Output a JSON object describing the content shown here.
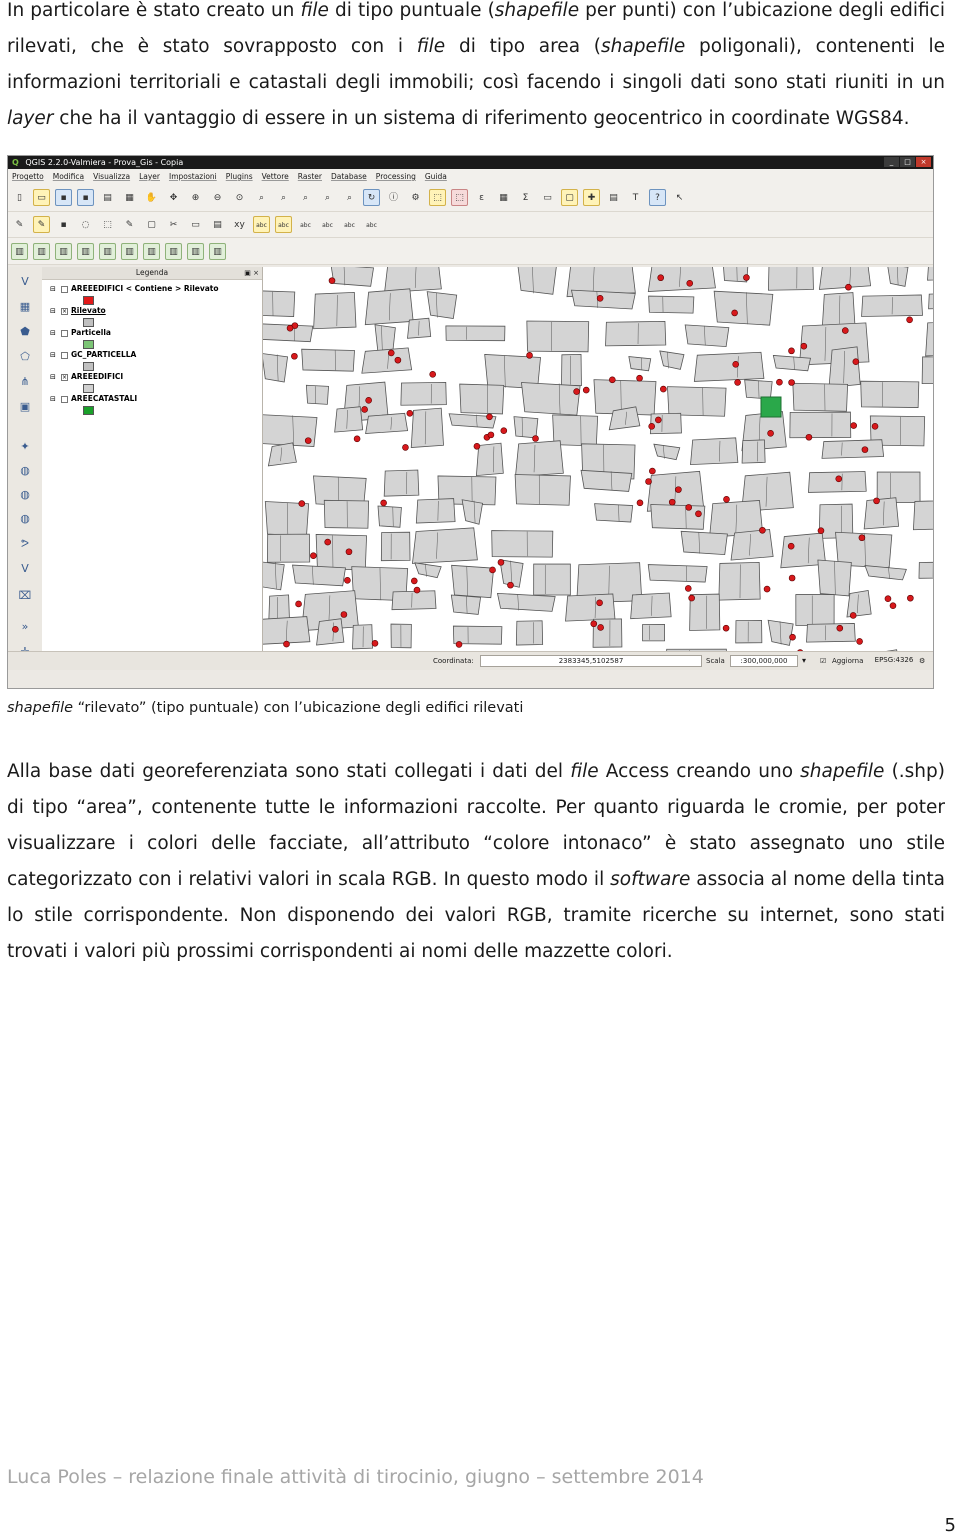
{
  "paragraph1": {
    "runs": [
      {
        "t": "In particolare è stato creato un ",
        "i": false
      },
      {
        "t": "file",
        "i": true
      },
      {
        "t": " di tipo puntuale (",
        "i": false
      },
      {
        "t": "shapefile",
        "i": true
      },
      {
        "t": " per punti) con l’ubicazione degli edifici rilevati, che è stato sovrapposto con i ",
        "i": false
      },
      {
        "t": "file",
        "i": true
      },
      {
        "t": " di tipo area (",
        "i": false
      },
      {
        "t": "shapefile",
        "i": true
      },
      {
        "t": " poligonali), contenenti le informazioni territoriali e catastali degli immobili; così facendo i singoli dati sono stati riuniti in un ",
        "i": false
      },
      {
        "t": "layer",
        "i": true
      },
      {
        "t": " che ha il vantaggio di essere in un sistema di riferimento geocentrico in coordinate WGS84.",
        "i": false
      }
    ]
  },
  "screenshot": {
    "window_title": "QGIS 2.2.0-Valmiera - Prova_Gis - Copia",
    "menu": [
      "Progetto",
      "Modifica",
      "Visualizza",
      "Layer",
      "Impostazioni",
      "Plugins",
      "Vettore",
      "Raster",
      "Database",
      "Processing",
      "Guida"
    ],
    "toolbar_labels": {
      "xy": "xy",
      "abc": "abc"
    },
    "legend": {
      "title": "Legenda",
      "layers": [
        {
          "name": "AREEEDIFICI < Contiene > Rilevato",
          "checked": false,
          "color": "#e21a1a"
        },
        {
          "name": "Rilevato",
          "checked": true,
          "color": "#c0c0c0"
        },
        {
          "name": "Particella",
          "checked": false,
          "color": "#7cc576"
        },
        {
          "name": "GC_PARTICELLA",
          "checked": false,
          "color": "#c0c0c0"
        },
        {
          "name": "AREEEDIFICI",
          "checked": true,
          "color": "#d0d0d0"
        },
        {
          "name": "AREECATASTALI",
          "checked": false,
          "color": "#1aa02a"
        }
      ]
    },
    "statusbar": {
      "coord_label": "Coordinata:",
      "coord_value": "2383345,5102587",
      "scale_label": "Scala",
      "scale_value": ":300,000,000",
      "refresh_label": "Aggiorna",
      "crs": "EPSG:4326"
    },
    "colors": {
      "buildings_fill": "#d4d4d4",
      "buildings_stroke": "#555555",
      "points": "#d7191c"
    }
  },
  "caption": {
    "runs": [
      {
        "t": "shapefile",
        "i": true
      },
      {
        "t": " “rilevato” (tipo puntuale) con l’ubicazione degli edifici rilevati",
        "i": false
      }
    ]
  },
  "paragraph2": {
    "runs": [
      {
        "t": "Alla base dati georeferenziata sono stati collegati i dati del ",
        "i": false
      },
      {
        "t": "file",
        "i": true
      },
      {
        "t": " Access creando uno ",
        "i": false
      },
      {
        "t": "shapefile",
        "i": true
      },
      {
        "t": " (.shp) di tipo “area”, contenente tutte le informazioni raccolte. Per quanto riguarda le cromie, per poter visualizzare i colori delle facciate, all’attributo “colore intonaco” è stato assegnato uno stile categorizzato con i relativi valori in scala RGB. In questo modo il ",
        "i": false
      },
      {
        "t": "software",
        "i": true
      },
      {
        "t": " associa al nome della tinta lo stile corrispondente. Non disponendo dei valori RGB, tramite ricerche su internet, sono stati trovati i valori più prossimi corrispondenti ai nomi delle mazzette colori.",
        "i": false
      }
    ]
  },
  "footer": "Luca Poles – relazione finale attività di tirocinio, giugno – settembre 2014",
  "page_number": "5"
}
